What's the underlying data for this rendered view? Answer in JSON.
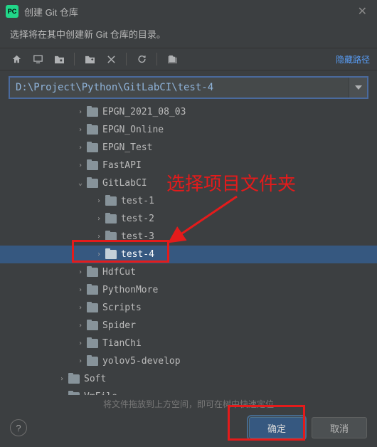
{
  "titlebar": {
    "title": "创建 Git 仓库"
  },
  "subtitle": "选择将在其中创建新 Git 仓库的目录。",
  "toolbar": {
    "hide_paths": "隐藏路径"
  },
  "path": {
    "value": "D:\\Project\\Python\\GitLabCI\\test-4"
  },
  "tree": [
    {
      "depth": 3,
      "expand": "right",
      "label": "EPGN_2021_08_03",
      "selected": false
    },
    {
      "depth": 3,
      "expand": "right",
      "label": "EPGN_Online",
      "selected": false
    },
    {
      "depth": 3,
      "expand": "right",
      "label": "EPGN_Test",
      "selected": false
    },
    {
      "depth": 3,
      "expand": "right",
      "label": "FastAPI",
      "selected": false
    },
    {
      "depth": 3,
      "expand": "down",
      "label": "GitLabCI",
      "selected": false
    },
    {
      "depth": 4,
      "expand": "right",
      "label": "test-1",
      "selected": false
    },
    {
      "depth": 4,
      "expand": "right",
      "label": "test-2",
      "selected": false
    },
    {
      "depth": 4,
      "expand": "right",
      "label": "test-3",
      "selected": false
    },
    {
      "depth": 4,
      "expand": "right",
      "label": "test-4",
      "selected": true
    },
    {
      "depth": 3,
      "expand": "right",
      "label": "HdfCut",
      "selected": false
    },
    {
      "depth": 3,
      "expand": "right",
      "label": "PythonMore",
      "selected": false
    },
    {
      "depth": 3,
      "expand": "right",
      "label": "Scripts",
      "selected": false
    },
    {
      "depth": 3,
      "expand": "right",
      "label": "Spider",
      "selected": false
    },
    {
      "depth": 3,
      "expand": "right",
      "label": "TianChi",
      "selected": false
    },
    {
      "depth": 3,
      "expand": "right",
      "label": "yolov5-develop",
      "selected": false
    },
    {
      "depth": 2,
      "expand": "right",
      "label": "Soft",
      "selected": false
    },
    {
      "depth": 2,
      "expand": "right",
      "label": "VmFile",
      "selected": false
    }
  ],
  "hint": "将文件拖放到上方空间，即可在树中快速定位",
  "buttons": {
    "ok": "确定",
    "cancel": "取消"
  },
  "callout": {
    "text": "选择项目文件夹"
  }
}
